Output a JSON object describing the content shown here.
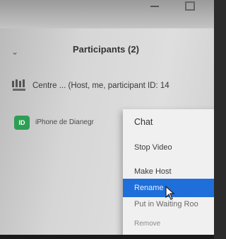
{
  "participants_panel": {
    "title": "Participants (2)",
    "participants": [
      {
        "avatar": "logo",
        "name": "Centre ... (Host, me, participant ID: 14"
      },
      {
        "avatar": "ID",
        "name": "iPhone de Dianegr"
      }
    ]
  },
  "context_menu": {
    "items": [
      {
        "label": "Chat"
      },
      {
        "label": "Stop Video"
      },
      {
        "label": "Make Host"
      },
      {
        "label": "Rename",
        "selected": true
      },
      {
        "label": "Put in Waiting Roo"
      },
      {
        "label": "Remove"
      }
    ]
  },
  "colors": {
    "selection": "#1e6fd9",
    "avatar_green": "#2e9e55",
    "panel_bg": "#dcdcdc"
  }
}
